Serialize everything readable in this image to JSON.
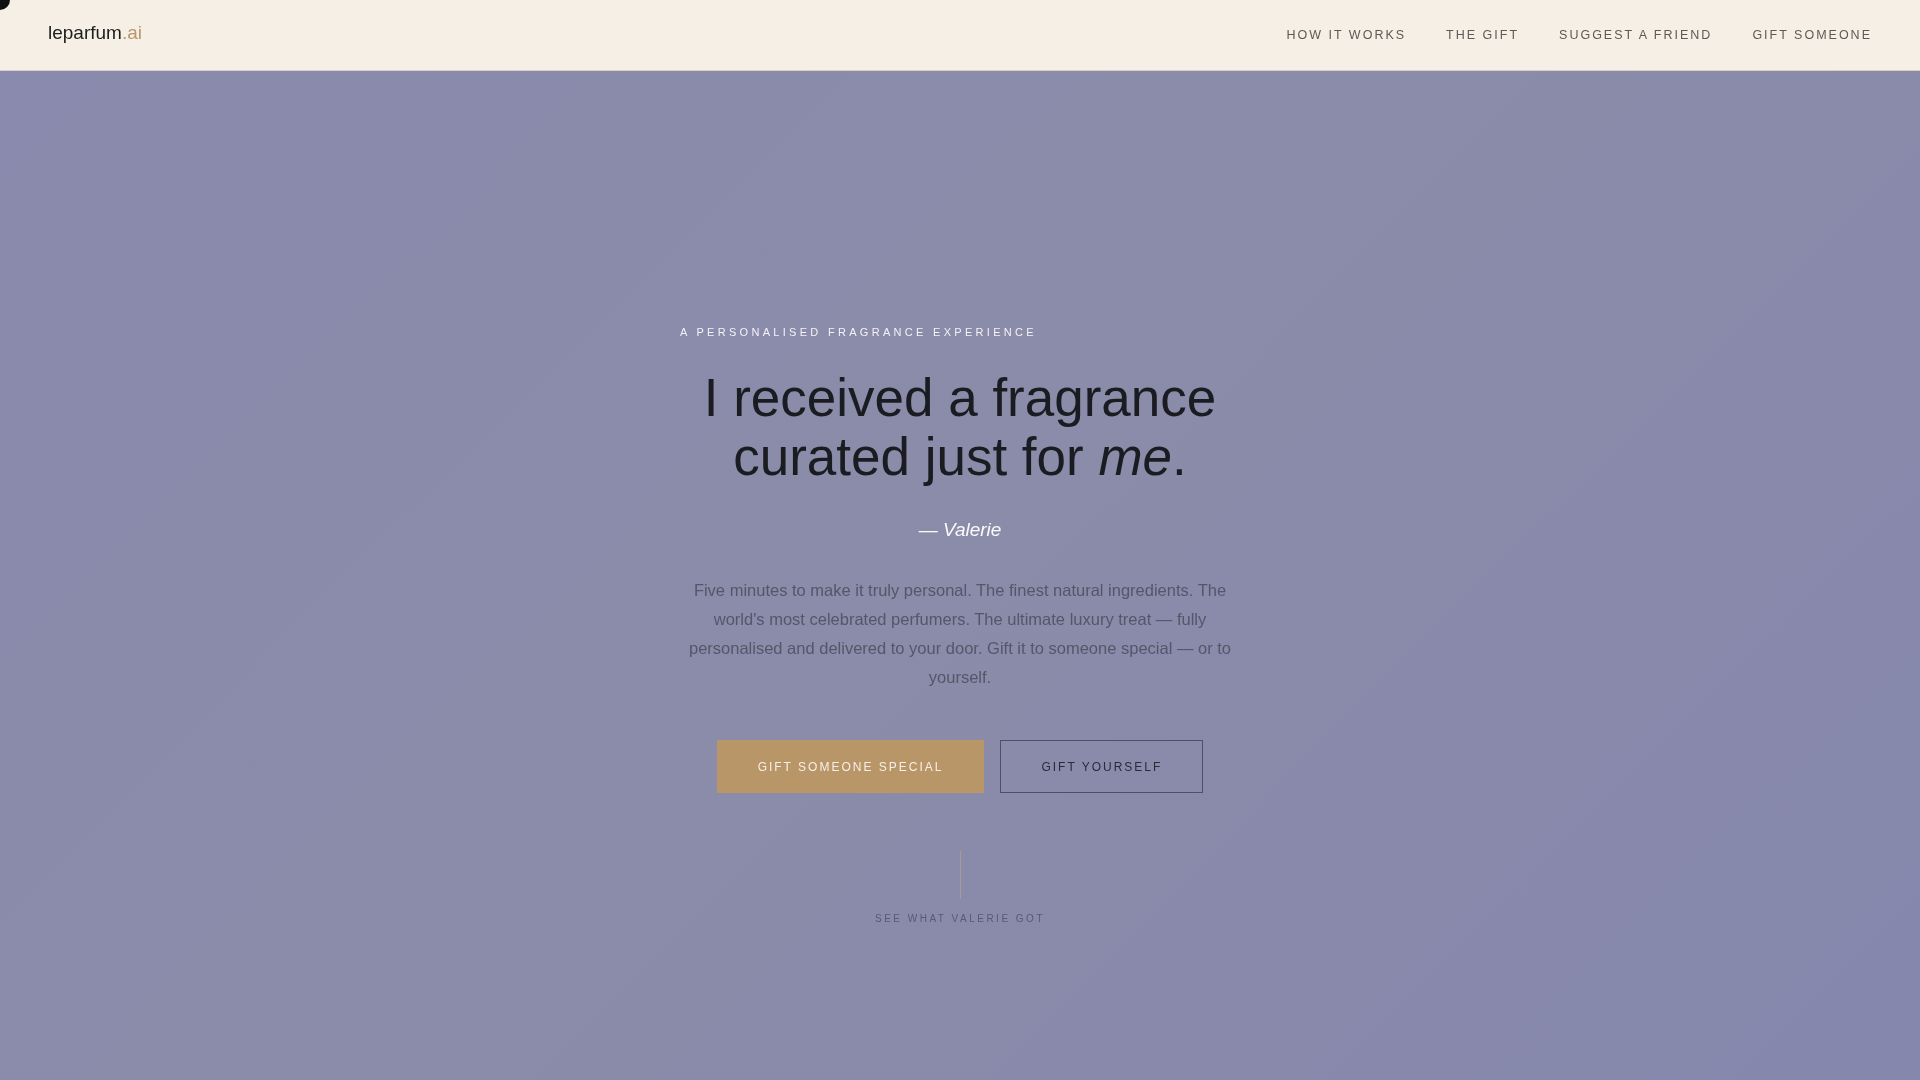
{
  "header": {
    "logo": {
      "name": "leparfum",
      "suffix": ".ai"
    },
    "nav": [
      "HOW IT WORKS",
      "THE GIFT",
      "SUGGEST A FRIEND",
      "GIFT SOMEONE"
    ]
  },
  "hero": {
    "eyebrow": "A PERSONALISED FRAGRANCE EXPERIENCE",
    "headline_lines": [
      "I received a fragrance",
      "curated just for *me*."
    ],
    "attribution": "— Valerie",
    "body": "Five minutes to make it truly personal. The finest natural ingredients. The world's most celebrated perfumers. The ultimate luxury treat — fully personalised and delivered to your door. Gift it to someone special — or to yourself.",
    "buttons": [
      {
        "label": "GIFT SOMEONE SPECIAL",
        "kind": "primary"
      },
      {
        "label": "GIFT YOURSELF",
        "kind": "outline"
      }
    ],
    "scroll_hint": "SEE WHAT VALERIE GOT"
  }
}
